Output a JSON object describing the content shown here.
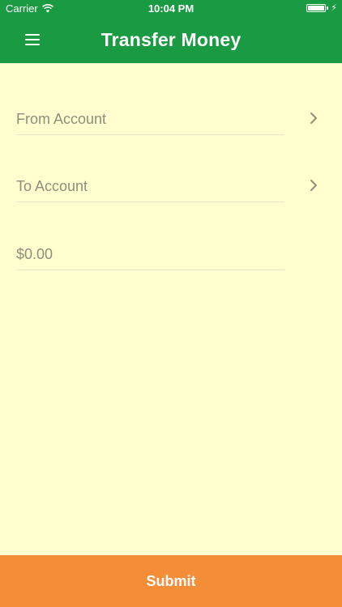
{
  "status_bar": {
    "carrier": "Carrier",
    "time": "10:04 PM",
    "bolt": "⚡"
  },
  "header": {
    "title": "Transfer Money",
    "menu_icon": "hamburger-menu-icon"
  },
  "form": {
    "from_account": {
      "label": "From Account",
      "icon": "chevron-right-icon"
    },
    "to_account": {
      "label": "To Account",
      "icon": "chevron-right-icon"
    },
    "amount": {
      "placeholder": "$0.00",
      "value": ""
    }
  },
  "footer": {
    "submit_label": "Submit"
  },
  "colors": {
    "header": "#1a9a42",
    "background": "#ffffcf",
    "submit": "#f48d37",
    "placeholder_text": "#8e8e7a"
  }
}
